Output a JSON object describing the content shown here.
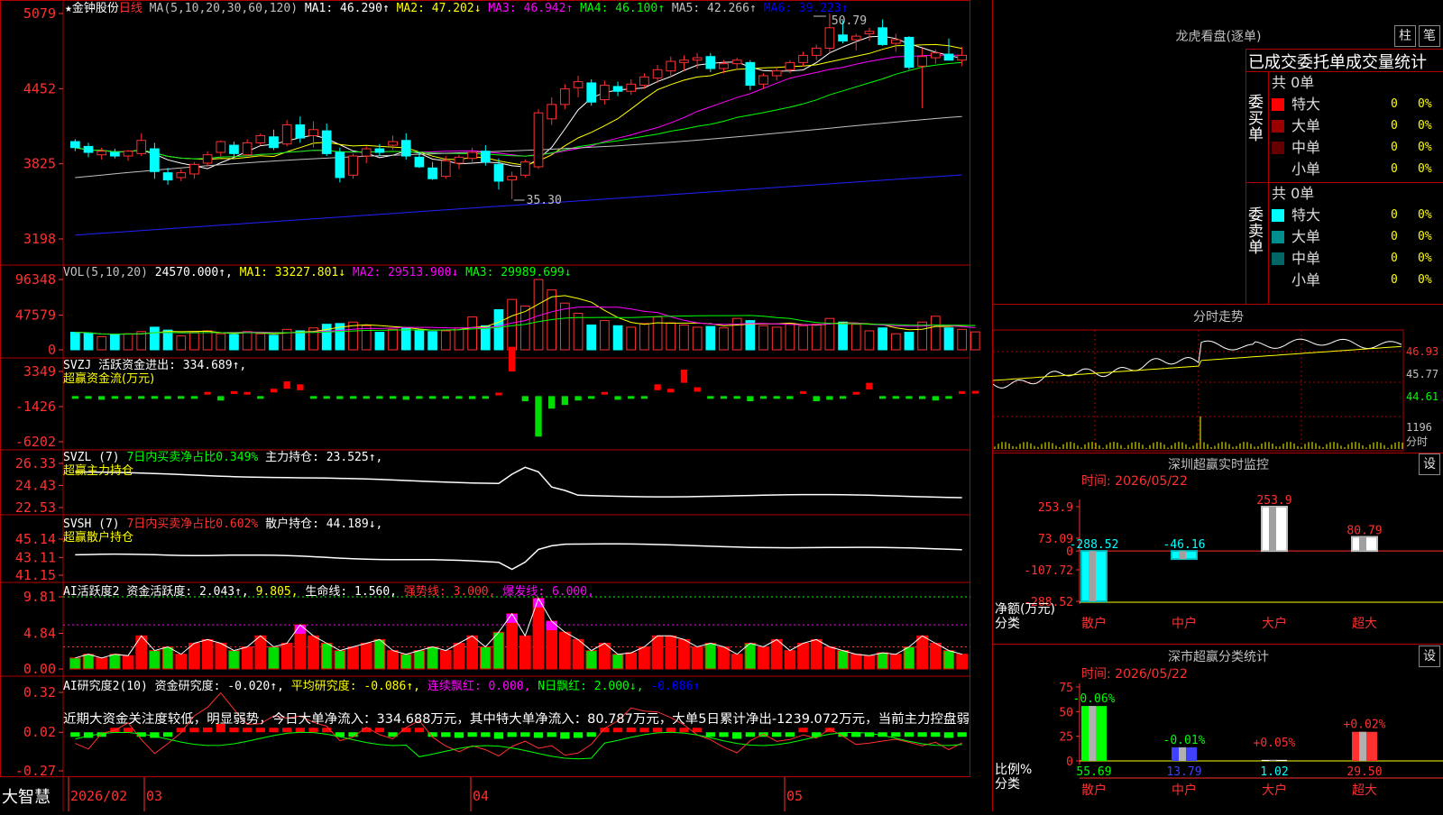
{
  "header": {
    "stock": "★金钟股份",
    "period": "日线",
    "ma_label": "MA(5,10,20,30,60,120)",
    "ma": [
      {
        "text": "MA1: 46.290↑",
        "color": "#ffffff"
      },
      {
        "text": "MA2: 47.202↓",
        "color": "#ffff00"
      },
      {
        "text": "MA3: 46.942↑",
        "color": "#ff00ff"
      },
      {
        "text": "MA4: 46.100↑",
        "color": "#00ff00"
      },
      {
        "text": "MA5: 42.266↑",
        "color": "#c0c0c0"
      },
      {
        "text": "MA6: 39.223↑",
        "color": "#0000ff"
      }
    ]
  },
  "price_panel": {
    "yticks": [
      "5079",
      "4452",
      "3825",
      "3198"
    ],
    "high_label": "50.79",
    "low_label": "35.30"
  },
  "vol_panel": {
    "label": "VOL(5,10,20)",
    "value": "24570.000↑",
    "ma": [
      {
        "text": "MA1: 33227.801↓",
        "color": "#ffff00"
      },
      {
        "text": "MA2: 29513.900↓",
        "color": "#ff00ff"
      },
      {
        "text": "MA3: 29989.699↓",
        "color": "#00ff00"
      }
    ],
    "yticks": [
      "96348",
      "47579",
      "0"
    ]
  },
  "svzj_panel": {
    "label": "SVZJ  活跃资金进出: 334.689↑,",
    "sublabel": "超赢资金流(万元)",
    "yticks": [
      "3349",
      "-1426",
      "-6202"
    ]
  },
  "svzl_panel": {
    "label1": "SVZL (7)",
    "label2": "7日内买卖净占比0.349%",
    "label3": "主力持仓: 23.525↑,",
    "sublabel": "超赢主力持仓",
    "yticks": [
      "26.33",
      "24.43",
      "22.53"
    ]
  },
  "svsh_panel": {
    "label1": "SVSH (7)",
    "label2": "7日内买卖净占比0.602%",
    "label3": "散户持仓: 44.189↓,",
    "sublabel": "超赢散户持仓",
    "yticks": [
      "45.14",
      "43.11",
      "41.15"
    ]
  },
  "ai_active_panel": {
    "label": "AI活跃度2",
    "items": [
      {
        "text": "资金活跃度: 2.043↑,",
        "color": "#ffffff"
      },
      {
        "text": "9.805,",
        "color": "#ffff00"
      },
      {
        "text": "生命线: 1.560,",
        "color": "#ffffff"
      },
      {
        "text": "强势线: 3.000,",
        "color": "#ff3030"
      },
      {
        "text": "爆发线: 6.000,",
        "color": "#ff00ff"
      }
    ],
    "yticks": [
      "9.81",
      "4.84",
      "0.00"
    ]
  },
  "ai_research_panel": {
    "label": "AI研究度2(10)",
    "items": [
      {
        "text": "资金研究度: -0.020↑,",
        "color": "#ffffff"
      },
      {
        "text": "平均研究度: -0.086↑,",
        "color": "#ffff00"
      },
      {
        "text": "连续飘红: 0.000,",
        "color": "#ff00ff"
      },
      {
        "text": "N日飘红: 2.000↓,",
        "color": "#00ff00"
      },
      {
        "text": "-0.086↑",
        "color": "#0000ff"
      }
    ],
    "comment": "近期大资金关注度较低，明显弱势，今日大单净流入：334.688万元，其中特大单净流入：80.787万元，大单5日累计净出-1239.072万元，当前主力控盘弱",
    "yticks": [
      "0.32",
      "0.02",
      "-0.27"
    ]
  },
  "footer": {
    "brand": "大智慧",
    "dates": [
      "2026/02",
      "03",
      "04",
      "05"
    ]
  },
  "longhu": {
    "title": "龙虎看盘(逐单)",
    "btn_zhu": "柱",
    "btn_bi": "笔",
    "tabs": "已成交委托单成交量统计",
    "buy_label": "委买单",
    "sell_label": "委卖单",
    "buy_total": "共 0单",
    "sell_total": "共 0单",
    "buy_rows": [
      {
        "name": "特大",
        "color": "#ff0000",
        "val": "0",
        "pct": "0%"
      },
      {
        "name": "大单",
        "color": "#990000",
        "val": "0",
        "pct": "0%"
      },
      {
        "name": "中单",
        "color": "#660000",
        "val": "0",
        "pct": "0%"
      },
      {
        "name": "小单",
        "color": "",
        "val": "0",
        "pct": "0%"
      }
    ],
    "sell_rows": [
      {
        "name": "特大",
        "color": "#00ffff",
        "val": "0",
        "pct": "0%"
      },
      {
        "name": "大单",
        "color": "#008f8f",
        "val": "0",
        "pct": "0%"
      },
      {
        "name": "中单",
        "color": "#006666",
        "val": "0",
        "pct": "0%"
      },
      {
        "name": "小单",
        "color": "",
        "val": "0",
        "pct": "0%"
      }
    ]
  },
  "intraday": {
    "title": "分时走势",
    "yticks": [
      "46.93",
      "45.77",
      "44.61"
    ],
    "vol_tick": "1196",
    "vol_label": "分时"
  },
  "sz_monitor": {
    "title": "深圳超赢实时监控",
    "btn": "设",
    "time": "时间: 2026/05/22",
    "yticks": [
      "253.9",
      "73.09",
      "0",
      "-107.72",
      "-288.52"
    ],
    "y_label1": "净额(万元)",
    "y_label2": "分类",
    "categories": [
      "散户",
      "中户",
      "大户",
      "超大"
    ],
    "values": [
      -288.52,
      -46.16,
      253.9,
      80.79
    ],
    "value_labels": [
      "-288.52",
      "-46.16",
      "253.9",
      "80.79"
    ]
  },
  "sz_class": {
    "title": "深市超赢分类统计",
    "btn": "设",
    "time": "时间: 2026/05/22",
    "yticks": [
      "75",
      "50",
      "25",
      "0"
    ],
    "y_label1": "比例%",
    "y_label2": "分类",
    "categories": [
      "散户",
      "中户",
      "大户",
      "超大"
    ],
    "values": [
      55.69,
      13.79,
      1.02,
      29.5
    ],
    "value_labels": [
      "55.69",
      "13.79",
      "1.02",
      "29.50"
    ],
    "change_labels": [
      "-0.06%",
      "-0.01%",
      "+0.05%",
      "+0.02%"
    ]
  },
  "chart_data": [
    {
      "type": "candlestick",
      "title": "★金钟股份 日线",
      "ylim": [
        31.98,
        50.79
      ],
      "ohlc": [
        [
          40.1,
          40.3,
          39.3,
          39.6
        ],
        [
          39.7,
          40.0,
          38.8,
          39.2
        ],
        [
          39.0,
          39.6,
          38.6,
          39.3
        ],
        [
          39.2,
          39.5,
          38.7,
          38.9
        ],
        [
          38.9,
          39.4,
          38.5,
          39.3
        ],
        [
          39.1,
          40.8,
          38.9,
          40.2
        ],
        [
          39.5,
          40.0,
          37.0,
          37.6
        ],
        [
          37.5,
          37.9,
          36.5,
          36.9
        ],
        [
          37.1,
          37.8,
          36.8,
          37.5
        ],
        [
          37.4,
          38.4,
          37.0,
          38.2
        ],
        [
          38.3,
          39.3,
          38.0,
          39.0
        ],
        [
          39.2,
          40.2,
          38.9,
          40.1
        ],
        [
          39.8,
          40.1,
          38.8,
          39.1
        ],
        [
          39.0,
          40.3,
          38.9,
          40.0
        ],
        [
          40.0,
          40.8,
          39.8,
          40.6
        ],
        [
          40.5,
          41.1,
          39.4,
          39.6
        ],
        [
          39.9,
          41.9,
          39.7,
          41.5
        ],
        [
          41.5,
          42.2,
          40.0,
          40.4
        ],
        [
          40.6,
          41.8,
          39.6,
          41.1
        ],
        [
          41.0,
          41.6,
          38.9,
          39.1
        ],
        [
          39.2,
          39.6,
          36.7,
          37.1
        ],
        [
          37.3,
          39.1,
          37.0,
          38.9
        ],
        [
          38.9,
          39.7,
          38.3,
          39.5
        ],
        [
          39.5,
          39.9,
          38.9,
          39.2
        ],
        [
          39.8,
          40.6,
          39.4,
          40.1
        ],
        [
          40.2,
          40.8,
          38.6,
          38.9
        ],
        [
          38.8,
          39.2,
          37.9,
          38.0
        ],
        [
          37.9,
          38.4,
          36.9,
          37.0
        ],
        [
          37.2,
          38.9,
          37.0,
          38.5
        ],
        [
          38.3,
          39.0,
          37.8,
          38.8
        ],
        [
          38.7,
          39.6,
          38.4,
          39.2
        ],
        [
          39.3,
          39.8,
          38.1,
          38.4
        ],
        [
          38.2,
          38.7,
          36.1,
          36.8
        ],
        [
          36.9,
          37.6,
          35.3,
          37.2
        ],
        [
          37.3,
          38.6,
          37.1,
          38.4
        ],
        [
          38.0,
          42.8,
          37.8,
          42.5
        ],
        [
          42.0,
          43.8,
          41.5,
          43.2
        ],
        [
          43.2,
          44.9,
          42.8,
          44.5
        ],
        [
          44.6,
          45.6,
          43.8,
          45.1
        ],
        [
          45.0,
          45.3,
          43.1,
          43.4
        ],
        [
          43.6,
          45.2,
          43.2,
          44.8
        ],
        [
          44.7,
          45.1,
          43.9,
          44.3
        ],
        [
          44.3,
          45.3,
          44.0,
          44.9
        ],
        [
          44.8,
          45.8,
          44.5,
          45.5
        ],
        [
          45.4,
          46.5,
          45.0,
          46.1
        ],
        [
          46.0,
          47.2,
          45.5,
          46.8
        ],
        [
          46.7,
          47.3,
          46.0,
          46.9
        ],
        [
          46.9,
          47.5,
          46.2,
          47.1
        ],
        [
          47.2,
          47.5,
          45.9,
          46.2
        ],
        [
          46.2,
          46.9,
          45.8,
          46.6
        ],
        [
          46.6,
          47.1,
          46.1,
          46.9
        ],
        [
          46.7,
          46.9,
          44.4,
          44.8
        ],
        [
          44.9,
          45.8,
          44.5,
          45.6
        ],
        [
          45.6,
          46.3,
          45.2,
          46.0
        ],
        [
          46.1,
          46.9,
          45.8,
          46.7
        ],
        [
          46.7,
          47.6,
          46.4,
          47.3
        ],
        [
          47.3,
          48.2,
          46.9,
          47.9
        ],
        [
          47.9,
          50.79,
          47.5,
          49.6
        ],
        [
          49.0,
          50.2,
          48.3,
          48.5
        ],
        [
          48.6,
          49.1,
          47.7,
          48.9
        ],
        [
          49.1,
          49.6,
          48.5,
          49.3
        ],
        [
          49.6,
          50.3,
          48.1,
          48.2
        ],
        [
          48.3,
          49.1,
          47.6,
          48.6
        ],
        [
          48.8,
          48.9,
          46.1,
          46.3
        ],
        [
          46.4,
          47.9,
          42.9,
          47.2
        ],
        [
          47.1,
          47.8,
          46.6,
          47.5
        ],
        [
          47.4,
          48.7,
          46.9,
          46.9
        ],
        [
          46.9,
          48.0,
          46.4,
          47.3
        ]
      ]
    },
    {
      "type": "bar",
      "title": "VOL(5,10,20)",
      "ylim": [
        0,
        96348
      ],
      "values": [
        24000,
        23000,
        18000,
        21000,
        22000,
        25000,
        31000,
        27000,
        19000,
        24000,
        26000,
        22000,
        21000,
        25000,
        22000,
        20000,
        28000,
        26000,
        30000,
        35000,
        36000,
        38000,
        33000,
        24000,
        28000,
        30000,
        27000,
        25000,
        26000,
        30000,
        45000,
        33000,
        55000,
        69000,
        60000,
        96348,
        82000,
        64000,
        50000,
        34000,
        40000,
        33000,
        31000,
        36000,
        45000,
        37000,
        34000,
        31000,
        32000,
        30000,
        43000,
        40000,
        33000,
        31000,
        36000,
        33000,
        35000,
        43000,
        38000,
        35000,
        26000,
        30000,
        22000,
        24000,
        38000,
        46000,
        30000,
        28000,
        24570
      ]
    },
    {
      "type": "bar",
      "title": "超赢资金流(万元)",
      "ylim": [
        -6202,
        3349
      ],
      "values": [
        -300,
        -200,
        -500,
        -100,
        -400,
        -200,
        -300,
        -400,
        -200,
        -100,
        200,
        -600,
        300,
        200,
        -300,
        500,
        1000,
        800,
        -200,
        -300,
        -400,
        -100,
        -200,
        -300,
        -200,
        -500,
        -100,
        -200,
        -300,
        -100,
        -400,
        -300,
        100,
        3349,
        -700,
        -5500,
        -1700,
        -1200,
        -600,
        -300,
        200,
        -500,
        -200,
        -100,
        800,
        500,
        1800,
        600,
        -300,
        -200,
        -100,
        -700,
        -300,
        -200,
        -400,
        300,
        -700,
        -500,
        -200,
        200,
        900,
        -300,
        -200,
        -100,
        -400,
        -600,
        -200,
        300,
        335
      ]
    }
  ]
}
